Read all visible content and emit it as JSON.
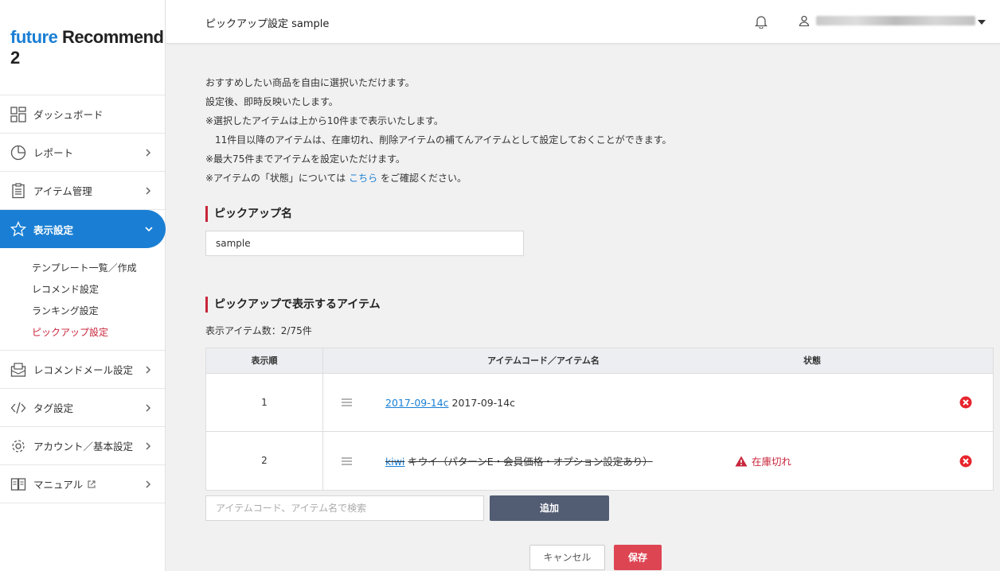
{
  "app": {
    "logo_part1": "future",
    "logo_part2": "Recommend 2"
  },
  "sidebar": {
    "items": [
      {
        "label": "ダッシュボード",
        "icon": "dashboard-icon"
      },
      {
        "label": "レポート",
        "icon": "pie-chart-icon"
      },
      {
        "label": "アイテム管理",
        "icon": "clipboard-icon"
      },
      {
        "label": "表示設定",
        "icon": "star-icon",
        "active": true
      },
      {
        "label": "レコメンドメール設定",
        "icon": "mail-icon"
      },
      {
        "label": "タグ設定",
        "icon": "code-icon"
      },
      {
        "label": "アカウント／基本設定",
        "icon": "gear-icon"
      },
      {
        "label": "マニュアル",
        "icon": "book-icon"
      }
    ],
    "submenu": [
      {
        "label": "テンプレート一覧／作成"
      },
      {
        "label": "レコメンド設定"
      },
      {
        "label": "ランキング設定"
      },
      {
        "label": "ピックアップ設定",
        "current": true
      }
    ]
  },
  "header": {
    "title": "ピックアップ設定 sample"
  },
  "intro": {
    "line1": "おすすめしたい商品を自由に選択いただけます。",
    "line2": "設定後、即時反映いたします。",
    "line3": "※選択したアイテムは上から10件まで表示いたします。",
    "line4": "11件目以降のアイテムは、在庫切れ、削除アイテムの補てんアイテムとして設定しておくことができます。",
    "line5": "※最大75件までアイテムを設定いただけます。",
    "line6_pre": "※アイテムの「状態」については",
    "line6_link": "こちら",
    "line6_post": "をご確認ください。"
  },
  "pickup_name": {
    "heading": "ピックアップ名",
    "value": "sample"
  },
  "items_section": {
    "heading": "ピックアップで表示するアイテム",
    "count_label": "表示アイテム数：2/75件",
    "columns": {
      "order": "表示順",
      "item": "アイテムコード／アイテム名",
      "status": "状態"
    },
    "rows": [
      {
        "order": "1",
        "code": "2017-09-14c",
        "name": "2017-09-14c",
        "status": "",
        "struck": false
      },
      {
        "order": "2",
        "code": "kiwi",
        "name": "キウイ（パターンE・会員価格・オプション設定あり）",
        "status": "在庫切れ",
        "struck": true
      }
    ],
    "search_placeholder": "アイテムコード、アイテム名で検索",
    "add_label": "追加"
  },
  "footer": {
    "cancel_label": "キャンセル",
    "save_label": "保存"
  },
  "colors": {
    "accent": "#1a7fd4",
    "brand_red": "#c8263b",
    "save": "#de4553",
    "add": "#525c73"
  }
}
